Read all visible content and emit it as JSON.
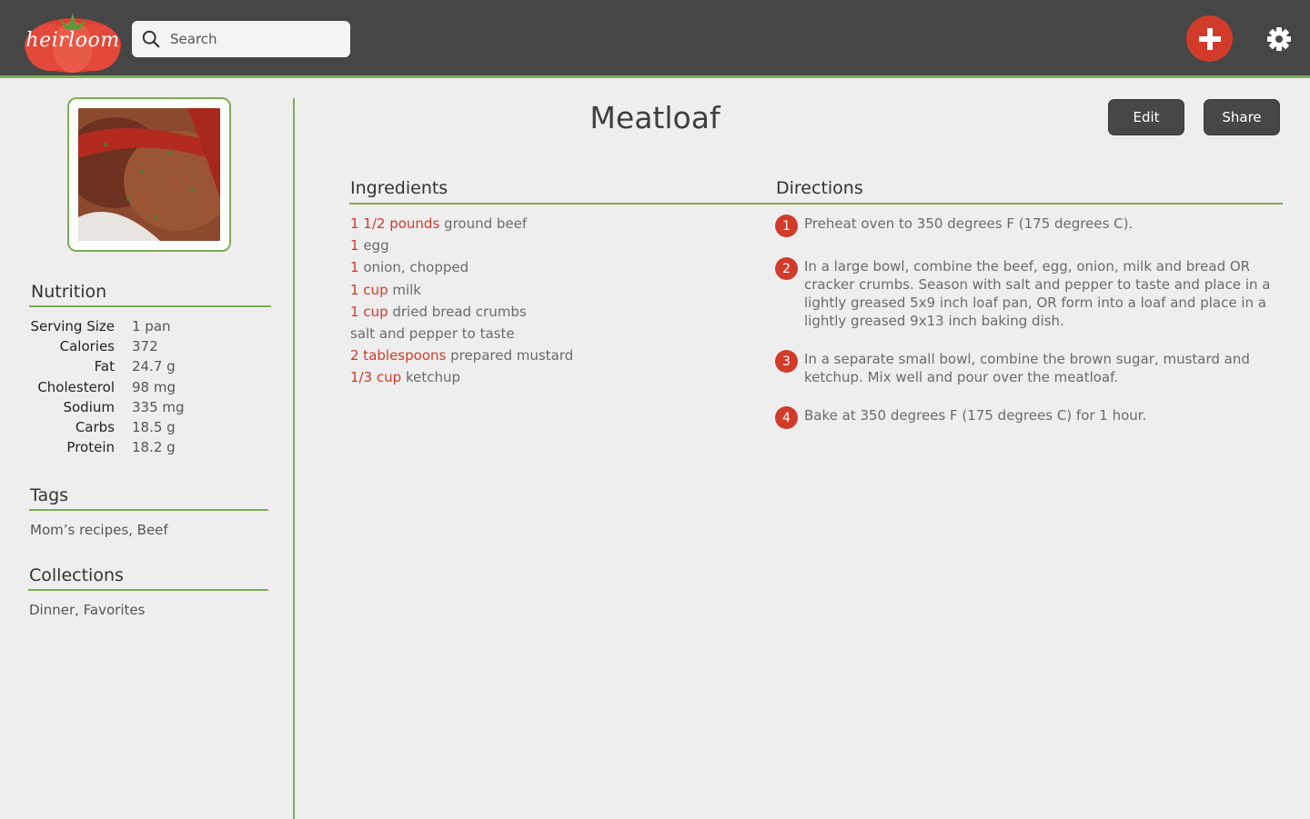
{
  "app": {
    "logo_text": "heirloom",
    "colors": {
      "header": "#464646",
      "accent_green": "#7cae55",
      "accent_red": "#d13b2a"
    }
  },
  "header": {
    "search_placeholder": "Search",
    "add_icon": "plus-icon",
    "settings_icon": "gear-icon"
  },
  "recipe": {
    "title": "Meatloaf",
    "edit_label": "Edit",
    "share_label": "Share"
  },
  "sidebar": {
    "nutrition_title": "Nutrition",
    "nutrition": [
      {
        "label": "Serving Size",
        "value": "1 pan"
      },
      {
        "label": "Calories",
        "value": "372"
      },
      {
        "label": "Fat",
        "value": "24.7 g"
      },
      {
        "label": "Cholesterol",
        "value": "98 mg"
      },
      {
        "label": "Sodium",
        "value": "335 mg"
      },
      {
        "label": "Carbs",
        "value": "18.5 g"
      },
      {
        "label": "Protein",
        "value": "18.2 g"
      }
    ],
    "tags_title": "Tags",
    "tags": "Mom’s recipes, Beef",
    "collections_title": "Collections",
    "collections": "Dinner, Favorites"
  },
  "ingredients": {
    "title": "Ingredients",
    "items": [
      {
        "amount": "1 1/2 pounds",
        "name": " ground beef"
      },
      {
        "amount": "1",
        "name": " egg"
      },
      {
        "amount": "1",
        "name": " onion, chopped"
      },
      {
        "amount": "1 cup",
        "name": " milk"
      },
      {
        "amount": "1 cup",
        "name": " dried bread crumbs"
      },
      {
        "amount": "",
        "name": "salt and pepper to taste"
      },
      {
        "amount": "2 tablespoons",
        "name": " prepared mustard"
      },
      {
        "amount": "1/3 cup",
        "name": " ketchup"
      }
    ]
  },
  "directions": {
    "title": "Directions",
    "steps": [
      {
        "number": "1",
        "text": "Preheat oven to 350 degrees F (175 degrees C)."
      },
      {
        "number": "2",
        "text": "In a large bowl, combine the beef, egg, onion, milk and bread OR cracker crumbs. Season with salt and pepper to taste and place in a lightly greased 5x9 inch loaf pan, OR form into a loaf and place in a lightly greased 9x13 inch baking dish."
      },
      {
        "number": "3",
        "text": "In a separate small bowl, combine the brown sugar, mustard and ketchup. Mix well and pour over the meatloaf."
      },
      {
        "number": "4",
        "text": "Bake at 350 degrees F (175 degrees C) for 1 hour."
      }
    ]
  }
}
